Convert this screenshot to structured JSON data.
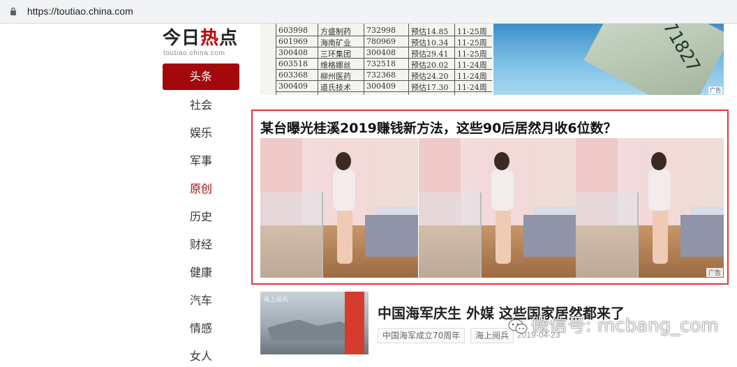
{
  "browser": {
    "url": "https://toutiao.china.com"
  },
  "logo": {
    "part1": "今日",
    "part2": "热",
    "part3": "点",
    "sub": "toutiao.china.com"
  },
  "nav": {
    "active": "头条",
    "items": [
      "社会",
      "娱乐",
      "军事",
      "原创",
      "历史",
      "财经",
      "健康",
      "汽车",
      "情感",
      "女人"
    ]
  },
  "stock_table": {
    "rows": [
      [
        "603998",
        "方盛制药",
        "732998",
        "预估14.85",
        "11-25周"
      ],
      [
        "601969",
        "海南矿业",
        "780969",
        "预估10.34",
        "11-25周"
      ],
      [
        "300408",
        "三环集团",
        "300408",
        "预估29.41",
        "11-25周"
      ],
      [
        "603518",
        "维格娜丝",
        "732518",
        "预估20.02",
        "11-24周"
      ],
      [
        "603368",
        "柳州医药",
        "732368",
        "预估24.20",
        "11-24周"
      ],
      [
        "300409",
        "道氏技术",
        "300409",
        "预估17.30",
        "11-24周"
      ]
    ]
  },
  "top_ad": {
    "bill_text": "71827",
    "ad_label": "广告"
  },
  "ad": {
    "title": "某台曝光桂溪2019赚钱新方法，这些90后居然月收6位数？",
    "ad_label": "广告"
  },
  "news": {
    "image_tag": "海上阅兵",
    "title": "中国海军庆生 外媒 这些国家居然都来了",
    "tags": [
      "中国海军成立70周年",
      "海上阅兵"
    ],
    "date": "2019-04-23"
  },
  "watermark": {
    "text": "微信号: mcbang_com"
  },
  "colors": {
    "brand_red": "#a3080c",
    "highlight_border": "#e53535"
  }
}
